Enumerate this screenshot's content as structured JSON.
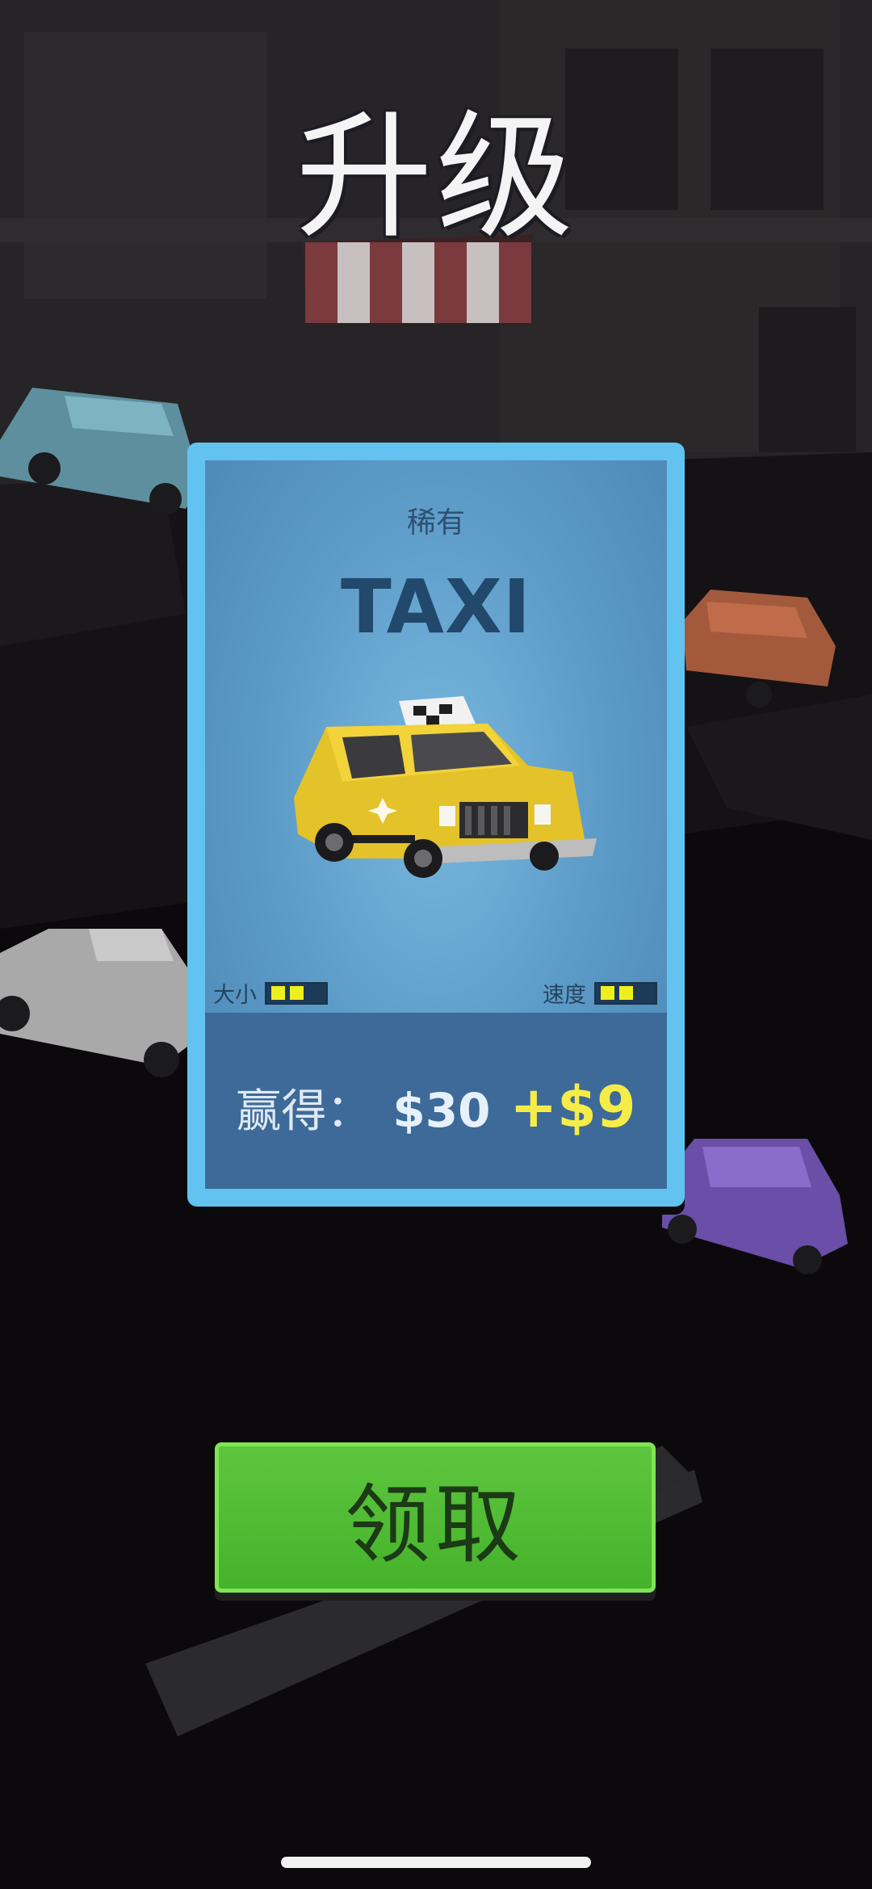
{
  "header": {
    "title": "升级"
  },
  "card": {
    "rarity": "稀有",
    "name": "TAXI",
    "stats": {
      "size_label": "大小",
      "size_level": 2,
      "size_max": 2,
      "speed_label": "速度",
      "speed_level": 2,
      "speed_max": 2
    },
    "reward": {
      "label": "赢得：",
      "amount": "$30",
      "bonus": "+$9"
    }
  },
  "actions": {
    "claim_label": "领取"
  },
  "colors": {
    "card_border": "#62c3f0",
    "bonus_text": "#f6ec47",
    "button_green": "#4fba32"
  }
}
